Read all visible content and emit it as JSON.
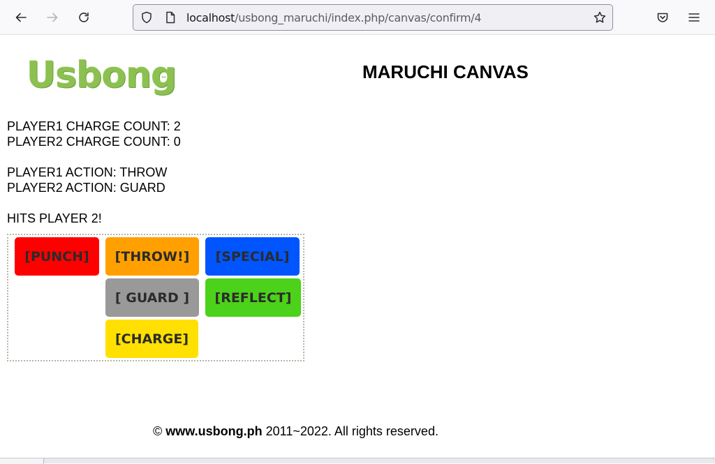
{
  "browser": {
    "url_host": "localhost",
    "url_path": "/usbong_maruchi/index.php/canvas/confirm/4"
  },
  "page": {
    "logo_text": "Usbong",
    "logo_tm": "™",
    "title": "MARUCHI CANVAS"
  },
  "status": {
    "player1_charge": "PLAYER1 CHARGE COUNT: 2",
    "player2_charge": "PLAYER2 CHARGE COUNT: 0",
    "player1_action": "PLAYER1 ACTION: THROW",
    "player2_action": "PLAYER2 ACTION: GUARD",
    "result": "HITS PLAYER 2!"
  },
  "actions": {
    "punch": "[PUNCH]",
    "throw": "[THROW!]",
    "special": "[SPECIAL]",
    "guard": "[ GUARD ]",
    "reflect": "[REFLECT]",
    "charge": "[CHARGE]"
  },
  "colors": {
    "punch": "#ff0000",
    "throw": "#ffa000",
    "special": "#0055ff",
    "guard": "#999999",
    "reflect": "#4cd21a",
    "charge": "#ffe000"
  },
  "footer": {
    "copyright_symbol": "©",
    "site": "www.usbong.ph",
    "rights": "2011~2022. All rights reserved."
  }
}
